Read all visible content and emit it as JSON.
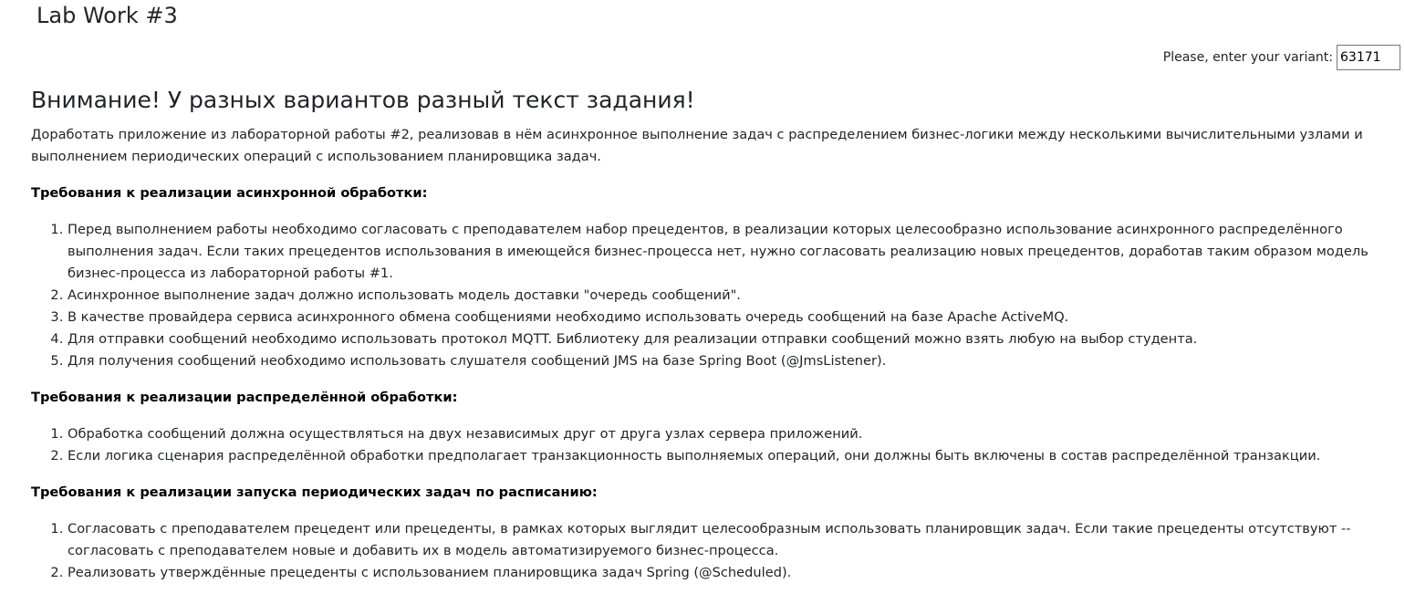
{
  "header": {
    "title": "Lab Work #3"
  },
  "variant": {
    "label": "Please, enter your variant:",
    "value": "63171"
  },
  "task": {
    "heading": "Внимание! У разных вариантов разный текст задания!",
    "intro": "Доработать приложение из лабораторной работы #2, реализовав в нём асинхронное выполнение задач с распределением бизнес-логики между несколькими вычислительными узлами и выполнением периодических операций с использованием планировщика задач.",
    "sections": [
      {
        "heading": "Требования к реализации асинхронной обработки:",
        "items": [
          "Перед выполнением работы необходимо согласовать с преподавателем набор прецедентов, в реализации которых целесообразно использование асинхронного распределённого выполнения задач. Если таких прецедентов использования в имеющейся бизнес-процесса нет, нужно согласовать реализацию новых прецедентов, доработав таким образом модель бизнес-процесса из лабораторной работы #1.",
          "Асинхронное выполнение задач должно использовать модель доставки \"очередь сообщений\".",
          "В качестве провайдера сервиса асинхронного обмена сообщениями необходимо использовать очередь сообщений на базе Apache ActiveMQ.",
          "Для отправки сообщений необходимо использовать протокол MQTT. Библиотеку для реализации отправки сообщений можно взять любую на выбор студента.",
          "Для получения сообщений необходимо использовать слушателя сообщений JMS на базе Spring Boot (@JmsListener)."
        ]
      },
      {
        "heading": "Требования к реализации распределённой обработки:",
        "items": [
          "Обработка сообщений должна осуществляться на двух независимых друг от друга узлах сервера приложений.",
          "Если логика сценария распределённой обработки предполагает транзакционность выполняемых операций, они должны быть включены в состав распределённой транзакции."
        ]
      },
      {
        "heading": "Требования к реализации запуска периодических задач по расписанию:",
        "items": [
          "Согласовать с преподавателем прецедент или прецеденты, в рамках которых выглядит целесообразным использовать планировщик задач. Если такие прецеденты отсутствуют -- согласовать с преподавателем новые и добавить их в модель автоматизируемого бизнес-процесса.",
          "Реализовать утверждённые прецеденты с использованием планировщика задач Spring (@Scheduled)."
        ]
      }
    ]
  }
}
